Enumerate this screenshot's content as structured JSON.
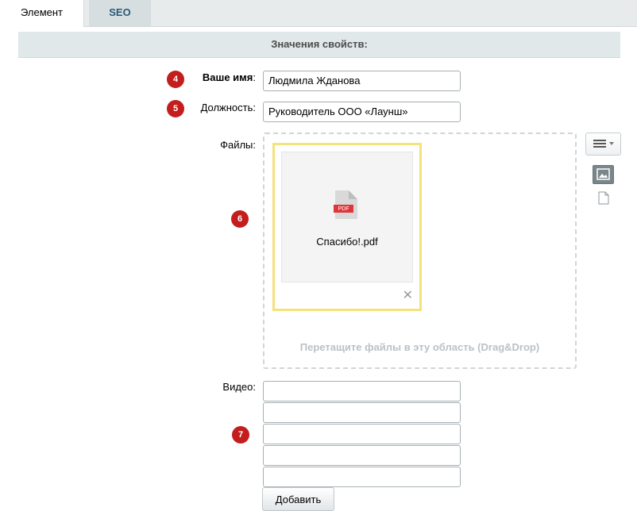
{
  "tabs": [
    {
      "label": "Элемент",
      "active": true
    },
    {
      "label": "SEO",
      "active": false
    }
  ],
  "section": {
    "title": "Значения свойств:"
  },
  "fields": {
    "name": {
      "badge": "4",
      "label": "Ваше имя",
      "colon": ":",
      "value": "Людмила Жданова"
    },
    "position": {
      "badge": "5",
      "label": "Должность:",
      "value": "Руководитель ООО «Лаунш»"
    },
    "files": {
      "badge": "6",
      "label": "Файлы:",
      "file_name": "Спасибо!.pdf",
      "file_type": "PDF",
      "remove_glyph": "✕",
      "drop_hint": "Перетащите файлы в эту область (Drag&Drop)"
    },
    "video": {
      "badge": "7",
      "label": "Видео:",
      "values": [
        "",
        "",
        "",
        "",
        ""
      ],
      "add_label": "Добавить"
    }
  },
  "icons": {
    "menu": "menu-dropdown-icon",
    "image_view": "image-icon",
    "file_view": "document-icon",
    "pdf": "pdf-file-icon"
  },
  "colors": {
    "badge": "#c41d1d",
    "file_card_border": "#f4e27c",
    "drop_hint": "#b9c2c6",
    "inactive_tab_text": "#2a5a78",
    "pdf_label": "#e0353b"
  }
}
